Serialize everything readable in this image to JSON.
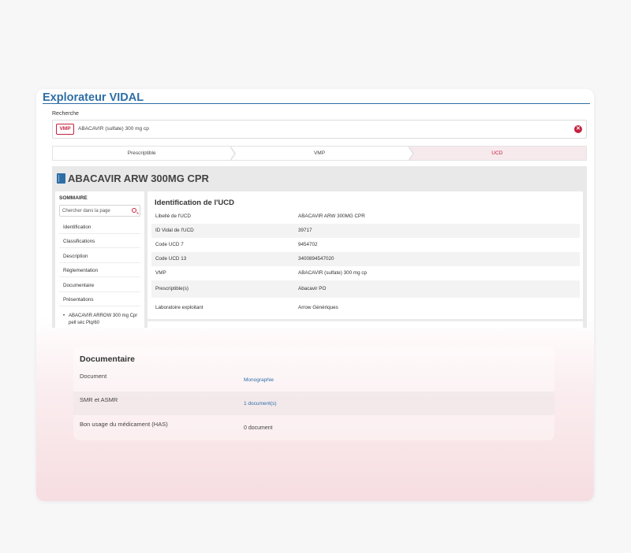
{
  "header": {
    "app_title": "Explorateur VIDAL"
  },
  "search": {
    "label": "Recherche",
    "chip": "VMP",
    "value": "ABACAVIR (sulfate) 300 mg cp",
    "clear_icon": "close-circle-icon"
  },
  "steps": [
    {
      "label": "Prescriptible",
      "active": false
    },
    {
      "label": "VMP",
      "active": false
    },
    {
      "label": "UCD",
      "active": true
    }
  ],
  "product": {
    "title": "ABACAVIR ARW 300MG CPR",
    "icon": "book-icon"
  },
  "sommaire": {
    "title": "SOMMAIRE",
    "search_placeholder": "Chercher dans la page",
    "items": [
      "Identification",
      "Classifications",
      "Description",
      "Réglementation",
      "Documentaire",
      "Présentations"
    ],
    "sub_item": "ABACAVIR ARROW 300 mg Cpr pell séc Plq/60"
  },
  "ucd": {
    "title": "Identification de l'UCD",
    "rows": [
      {
        "label": "Libellé de l'UCD",
        "value": "ABACAVIR ARW 300MG CPR"
      },
      {
        "label": "ID Vidal de l'UCD",
        "value": "39717"
      },
      {
        "label": "Code UCD 7",
        "value": "9454702"
      },
      {
        "label": "Code UCD 13",
        "value": "3400894547020"
      },
      {
        "label": "VMP",
        "value": "ABACAVIR (sulfate) 300 mg cp"
      },
      {
        "label": "Prescriptible(s)",
        "value": "Abacavir PO"
      },
      {
        "label": "Laboratoire exploitant",
        "value": "Arrow Génériques"
      }
    ]
  },
  "documentaire": {
    "title": "Documentaire",
    "rows": [
      {
        "label": "Document",
        "value": "Monographie"
      },
      {
        "label": "SMR et ASMR",
        "value": "1 document(s)"
      },
      {
        "label": "Bon usage du médicament (HAS)",
        "value": "0 document"
      }
    ]
  },
  "colors": {
    "accent": "#c4223f",
    "brand": "#2e6ea6"
  }
}
